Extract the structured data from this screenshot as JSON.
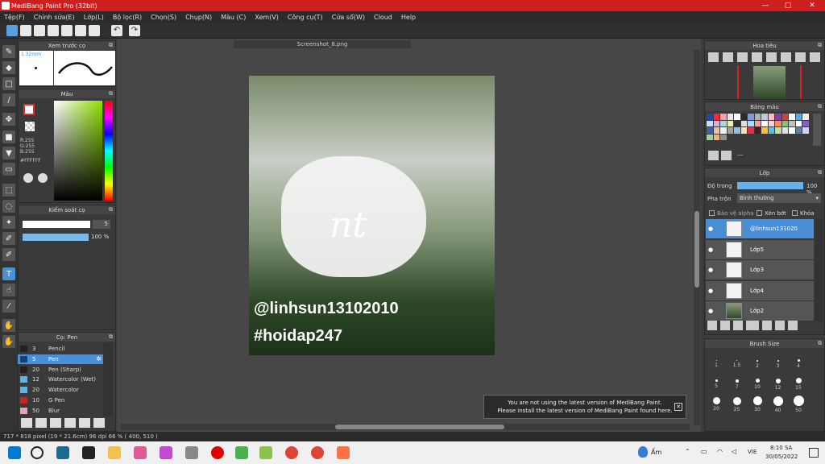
{
  "window": {
    "title": "MediBang Paint Pro (32bit)",
    "minimize": "—",
    "maximize": "▢",
    "close": "✕"
  },
  "menu": [
    "Tệp(F)",
    "Chỉnh sửa(E)",
    "Lớp(L)",
    "Bộ lọc(R)",
    "Chọn(S)",
    "Chụp(N)",
    "Màu (C)",
    "Xem(V)",
    "Công cụ(T)",
    "Cửa sổ(W)",
    "Cloud",
    "Help"
  ],
  "preview": {
    "title": "Xem trước cọ",
    "size": "1.32mm"
  },
  "color": {
    "title": "Màu",
    "r": "R:255",
    "g": "G:255",
    "b": "B:255",
    "hex": "#FFFFFF"
  },
  "brush_control": {
    "title": "Kiểm soát cọ",
    "size_value": "5",
    "opacity_value": "100 %",
    "opacity_fraction": 1.0
  },
  "brushes": {
    "title": "Cọ: Pen",
    "items": [
      {
        "num": "3",
        "name": "Pencil",
        "color": "#222222"
      },
      {
        "num": "5",
        "name": "Pen",
        "color": "#1e3f6e",
        "selected": true
      },
      {
        "num": "20",
        "name": "Pen (Sharp)",
        "color": "#222222"
      },
      {
        "num": "12",
        "name": "Watercolor (Wet)",
        "color": "#5ab4e6"
      },
      {
        "num": "20",
        "name": "Watercolor",
        "color": "#5ab4e6"
      },
      {
        "num": "10",
        "name": "G Pen",
        "color": "#d02020"
      },
      {
        "num": "50",
        "name": "Blur",
        "color": "#e8a0c0"
      }
    ]
  },
  "document": {
    "tab": "Screenshot_8.png",
    "line1": "@linhsun13102010",
    "line2": "#hoidap247"
  },
  "navigator": {
    "title": "Hoa tiêu"
  },
  "palette": {
    "title": "Bảng màu",
    "label": "---"
  },
  "layers": {
    "title": "Lớp",
    "opacity_label": "Độ trong",
    "opacity_value": "100 %",
    "blend_label": "Pha trộn",
    "blend_value": "Bình thường",
    "protect_alpha": "Bảo vệ alpha",
    "clipping": "Xén bớt",
    "lock": "Khóa",
    "items": [
      {
        "name": "@linhsun131020",
        "selected": true
      },
      {
        "name": "Lớp5"
      },
      {
        "name": "Lớp3"
      },
      {
        "name": "Lớp4"
      },
      {
        "name": "Lớp2"
      }
    ]
  },
  "brush_size": {
    "title": "Brush Size",
    "sizes": [
      "1",
      "1.5",
      "2",
      "3",
      "4",
      "5",
      "7",
      "10",
      "12",
      "15",
      "20",
      "25",
      "30",
      "40",
      "50"
    ]
  },
  "notice": {
    "line1": "You are not using the latest version of MediBang Paint.",
    "line2": "Please install the latest version of MediBang Paint found here."
  },
  "status": {
    "text": "717 * 818 pixel  (19 * 21.6cm)  96 dpi  66 %  ( 400, 510 )"
  },
  "taskbar": {
    "weather": "Ấm",
    "lang": "VIE",
    "time": "8:10 SA",
    "date": "30/05/2022"
  }
}
